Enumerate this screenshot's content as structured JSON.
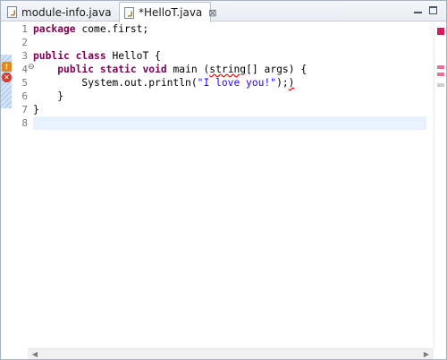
{
  "tabs": [
    {
      "label": "module-info.java",
      "icon": "java-file-icon",
      "active": false
    },
    {
      "label": "*HelloT.java",
      "icon": "java-file-icon",
      "active": true,
      "close": "⊠"
    }
  ],
  "window_controls": {
    "minimize": "minimize",
    "maximize": "maximize"
  },
  "editor": {
    "line_numbers": [
      "1",
      "2",
      "3",
      "4",
      "5",
      "6",
      "7",
      "8"
    ],
    "current_line": 8,
    "lines": [
      {
        "segments": [
          {
            "t": "package",
            "c": "kw"
          },
          {
            "t": " come.first;",
            "c": ""
          }
        ]
      },
      {
        "segments": [
          {
            "t": "",
            "c": ""
          }
        ]
      },
      {
        "segments": [
          {
            "t": "public",
            "c": "kw"
          },
          {
            "t": " ",
            "c": ""
          },
          {
            "t": "class",
            "c": "kw"
          },
          {
            "t": " HelloT {",
            "c": ""
          }
        ]
      },
      {
        "segments": [
          {
            "t": "    ",
            "c": ""
          },
          {
            "t": "public",
            "c": "kw"
          },
          {
            "t": " ",
            "c": ""
          },
          {
            "t": "static",
            "c": "kw"
          },
          {
            "t": " ",
            "c": ""
          },
          {
            "t": "void",
            "c": "kw"
          },
          {
            "t": " main (",
            "c": ""
          },
          {
            "t": "string",
            "c": "err-underline"
          },
          {
            "t": "[] args) {",
            "c": ""
          }
        ]
      },
      {
        "segments": [
          {
            "t": "        System.out.println(",
            "c": ""
          },
          {
            "t": "\"I love you!\"",
            "c": "str"
          },
          {
            "t": ");",
            "c": ""
          },
          {
            "t": ")",
            "c": "err-underline"
          }
        ]
      },
      {
        "segments": [
          {
            "t": "    }",
            "c": ""
          }
        ]
      },
      {
        "segments": [
          {
            "t": "}",
            "c": ""
          }
        ]
      },
      {
        "segments": [
          {
            "t": "",
            "c": ""
          }
        ]
      }
    ],
    "markers": {
      "warning": "warning-marker",
      "error": "error-marker"
    }
  },
  "colors": {
    "keyword": "#7f0055",
    "string": "#2a00ff",
    "error": "#d33a2e",
    "warning": "#e08a1e",
    "current_line": "#e8f2fe",
    "overview_error": "#e0185a"
  },
  "scrollbar": {
    "left_arrow": "◀",
    "right_arrow": "▶"
  }
}
